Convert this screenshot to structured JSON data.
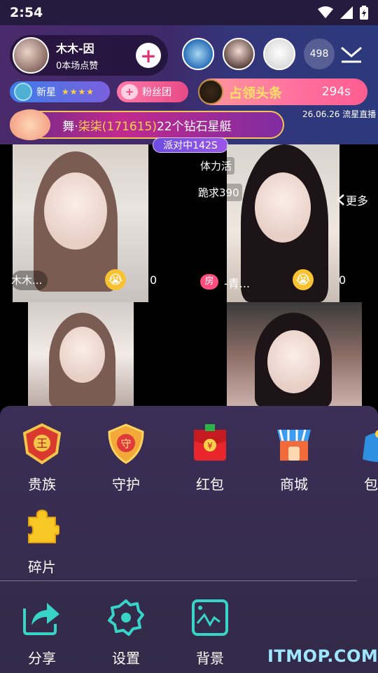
{
  "status_bar": {
    "time": "2:54"
  },
  "anchor": {
    "name": "木木-因",
    "likes": "0本场点赞"
  },
  "viewers": {
    "count": "498"
  },
  "badges": {
    "star_level": "新星",
    "stars": "★★★★",
    "fans": "粉丝团"
  },
  "headline": {
    "title": "占领头条",
    "timer": "294s"
  },
  "stamp": "26.06.26 流星直播",
  "gift_banner": {
    "prefix": "舞·",
    "user": "柒柒(171615)",
    "gift": "22个钻石星艇"
  },
  "party": "派对中142S",
  "tasks": {
    "stamina": "体力活",
    "kneel": "跪求390"
  },
  "more": "更多",
  "videos": [
    {
      "name": "木木...",
      "score": "0"
    },
    {
      "room_badge": "房",
      "name": "-青...",
      "score": "0"
    }
  ],
  "menu": {
    "row1": [
      {
        "label": "贵族",
        "icon": "crown-shield-icon"
      },
      {
        "label": "守护",
        "icon": "guard-shield-icon"
      },
      {
        "label": "红包",
        "icon": "red-envelope-icon"
      },
      {
        "label": "商城",
        "icon": "shop-icon"
      },
      {
        "label": "包",
        "icon": "bag-icon"
      }
    ],
    "row2": [
      {
        "label": "碎片",
        "icon": "puzzle-icon"
      }
    ],
    "row3": [
      {
        "label": "分享",
        "icon": "share-icon"
      },
      {
        "label": "设置",
        "icon": "settings-gear-icon"
      },
      {
        "label": "背景",
        "icon": "background-image-icon"
      }
    ]
  },
  "watermark": "ITMOP.COM",
  "colors": {
    "accent_pink": "#e74a86",
    "panel": "#3b2e57",
    "icon_teal": "#38d4c8"
  }
}
